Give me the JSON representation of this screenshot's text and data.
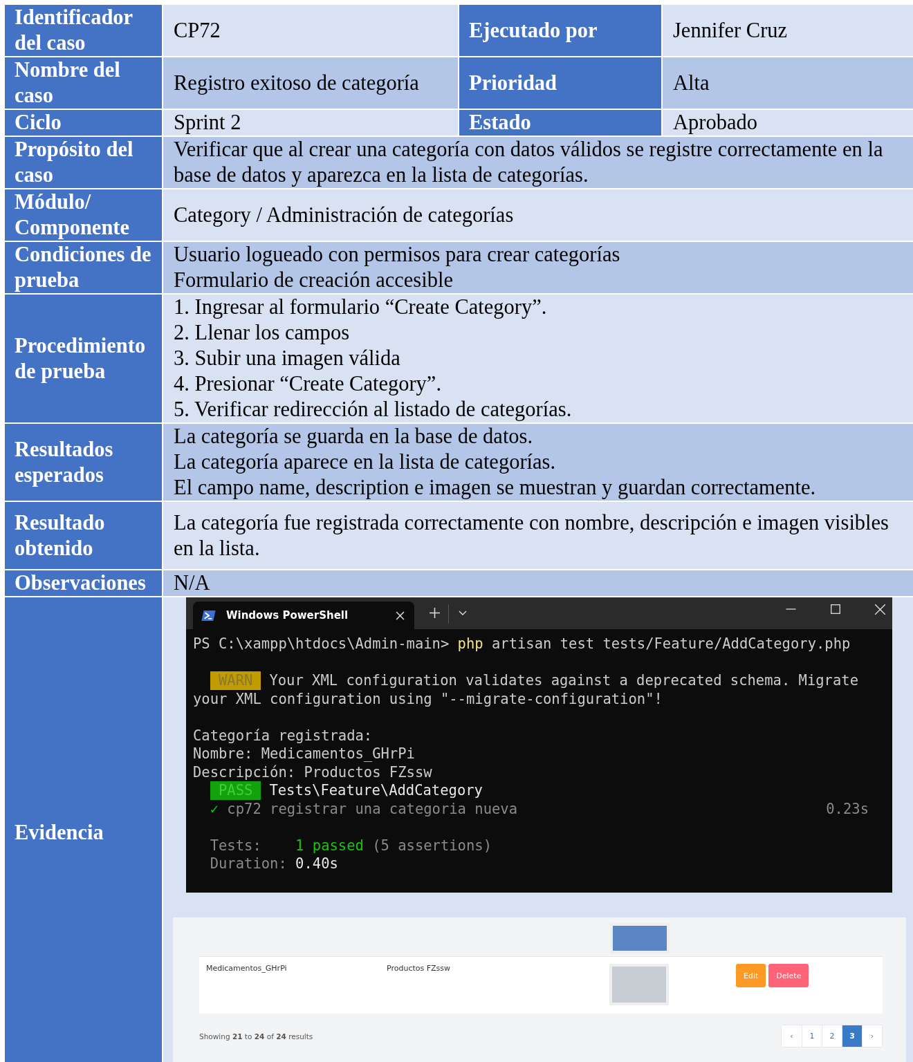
{
  "header_rows": [
    {
      "label": "Identificador del caso",
      "value": "CP72",
      "label2": "Ejecutado por",
      "value2": "Jennifer Cruz"
    },
    {
      "label": "Nombre del caso",
      "value": "Registro exitoso de categoría",
      "label2": "Prioridad",
      "value2": "Alta"
    },
    {
      "label": "Ciclo",
      "value": "Sprint 2",
      "label2": "Estado",
      "value2": "Aprobado"
    }
  ],
  "rows": [
    {
      "label": "Propósito del caso",
      "lines": [
        "Verificar que al crear una categoría con datos válidos se registre correctamente en la base de datos y aparezca en la lista de categorías."
      ]
    },
    {
      "label": "Módulo/ Componente",
      "lines": [
        "Category / Administración de categorías"
      ]
    },
    {
      "label": "Condiciones de prueba",
      "lines": [
        "Usuario logueado con permisos para crear categorías",
        "Formulario de creación accesible"
      ]
    },
    {
      "label": "Procedimiento de prueba",
      "lines": [
        "1. Ingresar al formulario “Create Category”.",
        "2. Llenar los campos",
        "3. Subir una imagen válida",
        "4. Presionar “Create Category”.",
        "5. Verificar redirección al listado de categorías."
      ]
    },
    {
      "label": "Resultados esperados",
      "lines": [
        "La categoría se guarda en la base de datos.",
        "La categoría aparece en la lista de categorías.",
        "El campo name, description e imagen se muestran y guardan correctamente."
      ]
    },
    {
      "label": "Resultado obtenido",
      "lines": [
        "La categoría fue registrada correctamente con nombre, descripción e imagen visibles en la lista."
      ]
    },
    {
      "label": "Observaciones",
      "lines": [
        "N/A"
      ]
    }
  ],
  "evidence": {
    "label": "Evidencia",
    "terminal": {
      "tab_title": "Windows PowerShell",
      "blocks": [
        [
          {
            "segments": [
              {
                "text": "PS C:\\xampp\\htdocs\\Admin-main> ",
                "kind": "plain"
              },
              {
                "text": "php",
                "kind": "command"
              },
              {
                "text": " artisan test tests/Feature/AddCategory.php",
                "kind": "plain"
              }
            ]
          }
        ],
        [
          {
            "segments": [
              {
                "text": "WARN",
                "kind": "warn_badge"
              },
              {
                "text": "Your XML configuration validates against a deprecated schema. Migrate",
                "kind": "plain"
              }
            ]
          },
          {
            "segments": [
              {
                "text": "your XML configuration using \"--migrate-configuration\"!",
                "kind": "plain"
              }
            ]
          }
        ],
        [
          {
            "segments": [
              {
                "text": "Categoría registrada:",
                "kind": "plain"
              }
            ]
          },
          {
            "segments": [
              {
                "text": "Nombre: Medicamentos_GHrPi",
                "kind": "plain"
              }
            ]
          },
          {
            "segments": [
              {
                "text": "Descripción: Productos FZssw",
                "kind": "plain"
              }
            ]
          },
          {
            "segments": [
              {
                "text": "PASS",
                "kind": "pass_badge"
              },
              {
                "text": "Tests\\Feature\\AddCategory",
                "kind": "bright"
              }
            ]
          },
          {
            "segments": [
              {
                "text": "  ✓",
                "kind": "success"
              },
              {
                "text": " cp72 registrar una categoria nueva",
                "kind": "dim"
              },
              {
                "text": "0.23s",
                "kind": "right"
              }
            ]
          }
        ],
        [
          {
            "segments": [
              {
                "text": "  Tests:    ",
                "kind": "dim"
              },
              {
                "text": "1 passed",
                "kind": "success"
              },
              {
                "text": " (5 assertions)",
                "kind": "dim"
              }
            ]
          },
          {
            "segments": [
              {
                "text": "  Duration: ",
                "kind": "dim"
              },
              {
                "text": "0.40s",
                "kind": "bright"
              }
            ]
          }
        ]
      ]
    },
    "app": {
      "rows": [
        {
          "kind": "partial"
        },
        {
          "kind": "full",
          "name": "Medicamentos_GHrPi",
          "description": "Productos FZssw",
          "actions": [
            {
              "label": "Edit",
              "kind": "edit"
            },
            {
              "label": "Delete",
              "kind": "delete"
            }
          ]
        }
      ],
      "summary": "Showing **21** to **24** of **24** results",
      "pages": [
        {
          "label": "‹",
          "selected": false
        },
        {
          "label": "1",
          "selected": false
        },
        {
          "label": "2",
          "selected": false
        },
        {
          "label": "3",
          "selected": true
        },
        {
          "label": "›",
          "selected": false
        }
      ]
    }
  }
}
